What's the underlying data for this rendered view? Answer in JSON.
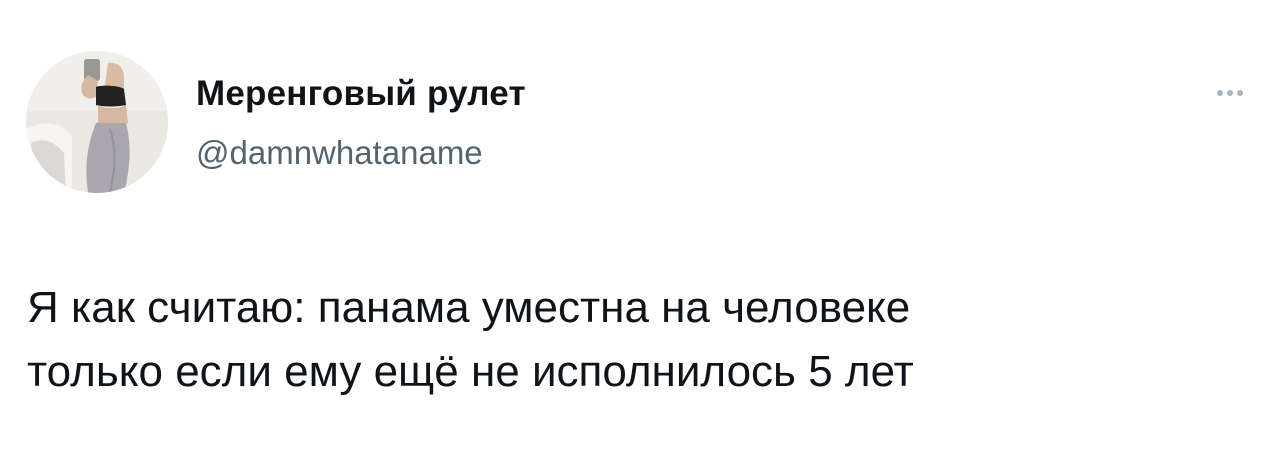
{
  "author": {
    "display_name": "Меренговый рулет",
    "handle": "@damnwhataname",
    "avatar": "profile-photo"
  },
  "actions": {
    "more_icon": "more-horizontal-icon"
  },
  "tweet": {
    "lines": [
      "Я как считаю: панама уместна на человеке",
      "только если ему ещё не исполнилось 5 лет"
    ]
  },
  "colors": {
    "text": "#0f1419",
    "secondary": "#536471",
    "dots": "#a8b4bd",
    "background": "#ffffff"
  }
}
